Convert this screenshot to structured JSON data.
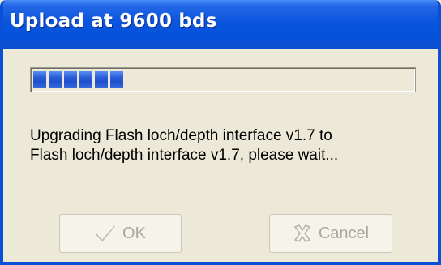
{
  "window": {
    "title": "Upload at 9600 bds"
  },
  "progress": {
    "value_fraction": 0.25,
    "segments_filled": 6,
    "color": "#2a5fd8"
  },
  "message": {
    "line1": "Upgrading Flash loch/depth interface  v1.7 to",
    "line2": "Flash loch/depth interface  v1.7, please wait..."
  },
  "buttons": {
    "ok_label": "OK",
    "ok_icon": "checkmark-icon",
    "ok_enabled": false,
    "cancel_label": "Cancel",
    "cancel_icon": "x-icon",
    "cancel_enabled": false
  },
  "colors": {
    "titlebar": "#0a55dd",
    "dialog_bg": "#ece9d8",
    "disabled_text": "#aca899"
  }
}
